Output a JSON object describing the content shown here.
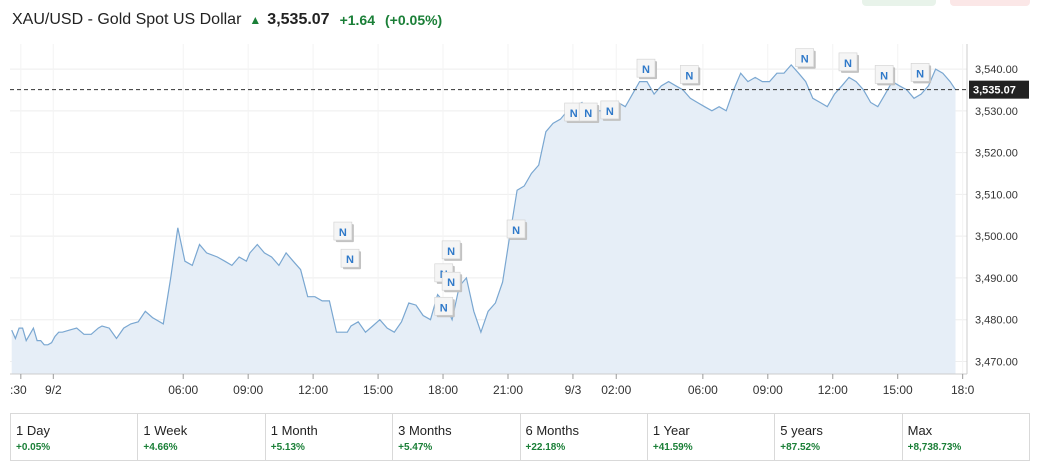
{
  "header": {
    "title": "XAU/USD - Gold Spot US Dollar",
    "price": "3,535.07",
    "change": "+1.64",
    "change_pct": "(+0.05%)"
  },
  "colors": {
    "positive": "#1a7f37",
    "line": "#7aa7d1",
    "fill": "#e6eef7",
    "marker_text": "#2f79c9"
  },
  "chart_data": {
    "type": "area",
    "ylim": [
      3467,
      3546
    ],
    "yticks": [
      3470,
      3480,
      3490,
      3500,
      3510,
      3520,
      3530,
      3540
    ],
    "ytick_labels": [
      "3,470.00",
      "3,480.00",
      "3,490.00",
      "3,500.00",
      "3,510.00",
      "3,520.00",
      "3,530.00",
      "3,540.00"
    ],
    "current_value": 3535.07,
    "current_label": "3,535.07",
    "xticks": [
      {
        "t": -1.5,
        "label": ":30"
      },
      {
        "t": 0,
        "label": "9/2"
      },
      {
        "t": 6,
        "label": "06:00"
      },
      {
        "t": 9,
        "label": "09:00"
      },
      {
        "t": 12,
        "label": "12:00"
      },
      {
        "t": 15,
        "label": "15:00"
      },
      {
        "t": 18,
        "label": "18:00"
      },
      {
        "t": 21,
        "label": "21:00"
      },
      {
        "t": 24,
        "label": "9/3"
      },
      {
        "t": 26,
        "label": "02:00"
      },
      {
        "t": 30,
        "label": "06:00"
      },
      {
        "t": 33,
        "label": "09:00"
      },
      {
        "t": 36,
        "label": "12:00"
      },
      {
        "t": 39,
        "label": "15:00"
      },
      {
        "t": 42,
        "label": "18:0"
      }
    ],
    "series": [
      {
        "x": [
          -1.92,
          -1.75,
          -1.58,
          -1.42,
          -1.25,
          -1.08,
          -0.92,
          -0.75,
          -0.58,
          -0.42,
          -0.25,
          -0.08,
          0.08,
          0.25,
          0.42,
          0.75,
          1.08,
          1.42,
          1.75,
          2.08,
          2.25,
          2.58,
          2.92,
          3.25,
          3.58,
          3.92,
          4.25,
          4.58,
          5.08,
          5.42,
          5.75,
          6.08,
          6.42,
          6.75,
          7.08,
          7.58,
          7.92,
          8.25,
          8.58,
          8.92,
          9.08,
          9.42,
          9.75,
          10.08,
          10.42,
          10.75,
          11.08,
          11.42,
          11.75,
          12.08,
          12.42,
          12.75,
          13.08,
          13.42,
          13.58,
          13.75,
          14.08,
          14.42,
          14.75,
          15.08,
          15.42,
          15.75,
          16.08,
          16.42,
          16.75,
          17.08,
          17.42,
          17.75,
          18.08,
          18.42,
          18.75,
          19.08,
          19.42,
          19.75,
          20.08,
          20.42,
          20.75,
          21.08,
          21.42,
          21.75,
          22.08,
          22.42,
          22.75,
          23.08,
          23.42,
          23.75,
          24.08,
          24.42,
          24.75,
          25.08,
          25.42,
          25.75,
          26.08,
          26.42,
          26.75,
          27.08,
          27.42,
          27.75,
          28.08,
          28.42,
          28.75,
          29.08,
          29.42,
          29.75,
          30.08,
          30.42,
          30.75,
          31.08,
          31.42,
          31.75,
          32.08,
          32.42,
          32.75,
          33.08,
          33.42,
          33.75,
          34.08,
          34.42,
          34.75,
          35.08,
          35.42,
          35.75,
          36.08,
          36.42,
          36.75,
          37.08,
          37.42,
          37.75,
          38.08,
          38.42,
          38.75,
          39.08,
          39.42,
          39.75,
          40.08,
          40.42,
          40.75,
          41.08,
          41.42,
          41.67
        ],
        "y": [
          3477.5,
          3475.5,
          3478,
          3478,
          3475,
          3476.5,
          3478,
          3475,
          3475,
          3474,
          3474,
          3474.5,
          3476,
          3477,
          3477,
          3477.5,
          3478,
          3476.5,
          3476.5,
          3478,
          3478.5,
          3478,
          3475.5,
          3478,
          3479,
          3479.5,
          3482,
          3480.5,
          3479,
          3490,
          3502,
          3494,
          3493,
          3498,
          3496,
          3495,
          3494,
          3493,
          3495,
          3494,
          3496,
          3498,
          3496,
          3495,
          3493,
          3496,
          3494,
          3492,
          3485.5,
          3485.5,
          3484.5,
          3484.5,
          3477,
          3477,
          3477,
          3478.5,
          3479.5,
          3477,
          3478.5,
          3480,
          3478,
          3477,
          3479.5,
          3484,
          3483.5,
          3481,
          3480,
          3486,
          3484,
          3480,
          3488,
          3490,
          3482,
          3477,
          3482,
          3484,
          3489,
          3500,
          3511,
          3512,
          3515,
          3517,
          3525,
          3527,
          3528,
          3530,
          3531,
          3532,
          3529,
          3530,
          3530,
          3531,
          3532,
          3531,
          3534,
          3537,
          3537,
          3534,
          3536,
          3537,
          3536,
          3535,
          3533,
          3532,
          3531,
          3530,
          3531,
          3530,
          3535,
          3539,
          3537,
          3538,
          3537,
          3537,
          3539,
          3539,
          3541,
          3539,
          3537,
          3533,
          3532,
          3531,
          3534,
          3536,
          3538,
          3537,
          3535,
          3532,
          3531,
          3534,
          3537,
          3536,
          3535,
          3533,
          3534,
          3536,
          3540,
          3539,
          3537,
          3535.07
        ],
        "markers": [
          {
            "t": 13.42,
            "v": 3500.5,
            "label": "N"
          },
          {
            "t": 13.75,
            "v": 3494,
            "label": "N"
          },
          {
            "t": 18.08,
            "v": 3490.5,
            "label": "N"
          },
          {
            "t": 18.42,
            "v": 3488.5,
            "label": "N"
          },
          {
            "t": 18.42,
            "v": 3496,
            "label": "N"
          },
          {
            "t": 18.08,
            "v": 3482.5,
            "label": "N"
          },
          {
            "t": 21.42,
            "v": 3501,
            "label": "N"
          },
          {
            "t": 24.08,
            "v": 3529,
            "label": "N"
          },
          {
            "t": 24.75,
            "v": 3529,
            "label": "N"
          },
          {
            "t": 25.75,
            "v": 3529.5,
            "label": "N"
          },
          {
            "t": 27.42,
            "v": 3539.5,
            "label": "N"
          },
          {
            "t": 29.42,
            "v": 3538,
            "label": "N"
          },
          {
            "t": 34.75,
            "v": 3542,
            "label": "N"
          },
          {
            "t": 36.75,
            "v": 3541,
            "label": "N"
          },
          {
            "t": 38.42,
            "v": 3538,
            "label": "N"
          },
          {
            "t": 40.08,
            "v": 3538.5,
            "label": "N"
          }
        ]
      }
    ]
  },
  "ranges": [
    {
      "label": "1 Day",
      "change": "+0.05%"
    },
    {
      "label": "1 Week",
      "change": "+4.66%"
    },
    {
      "label": "1 Month",
      "change": "+5.13%"
    },
    {
      "label": "3 Months",
      "change": "+5.47%"
    },
    {
      "label": "6 Months",
      "change": "+22.18%"
    },
    {
      "label": "1 Year",
      "change": "+41.59%"
    },
    {
      "label": "5 years",
      "change": "+87.52%"
    },
    {
      "label": "Max",
      "change": "+8,738.73%"
    }
  ]
}
